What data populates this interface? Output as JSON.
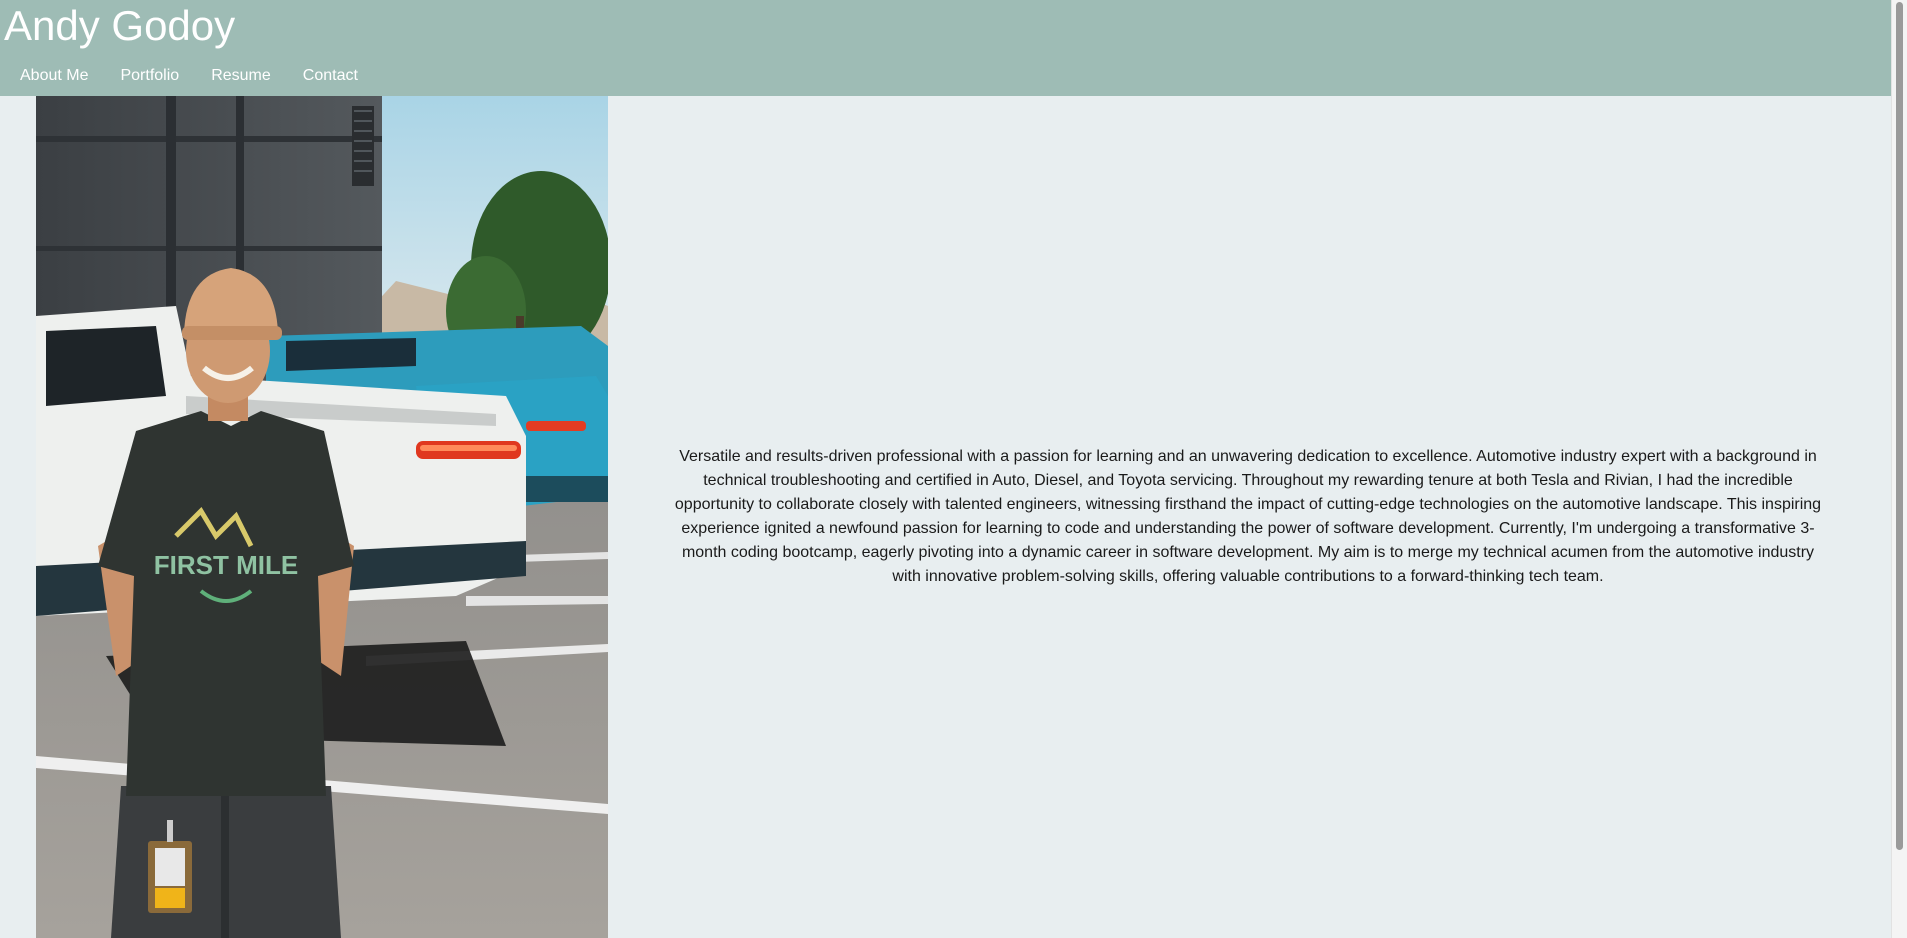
{
  "site": {
    "title": "Andy Godoy"
  },
  "nav": {
    "items": [
      {
        "label": "About Me"
      },
      {
        "label": "Portfolio"
      },
      {
        "label": "Resume"
      },
      {
        "label": "Contact"
      }
    ]
  },
  "about": {
    "photo_icon": "profile-photo",
    "bio": "Versatile and results-driven professional with a passion for learning and an unwavering dedication to excellence. Automotive industry expert with a background in technical troubleshooting and certified in Auto, Diesel, and Toyota servicing. Throughout my rewarding tenure at both Tesla and Rivian, I had the incredible opportunity to collaborate closely with talented engineers, witnessing firsthand the impact of cutting-edge technologies on the automotive landscape. This inspiring experience ignited a newfound passion for learning to code and understanding the power of software development. Currently, I'm undergoing a transformative 3-month coding bootcamp, eagerly pivoting into a dynamic career in software development. My aim is to merge my technical acumen from the automotive industry with innovative problem-solving skills, offering valuable contributions to a forward-thinking tech team."
  },
  "colors": {
    "header_bg": "#9ebcb5",
    "page_bg": "#e8eef0",
    "text": "#1a1a1a"
  }
}
